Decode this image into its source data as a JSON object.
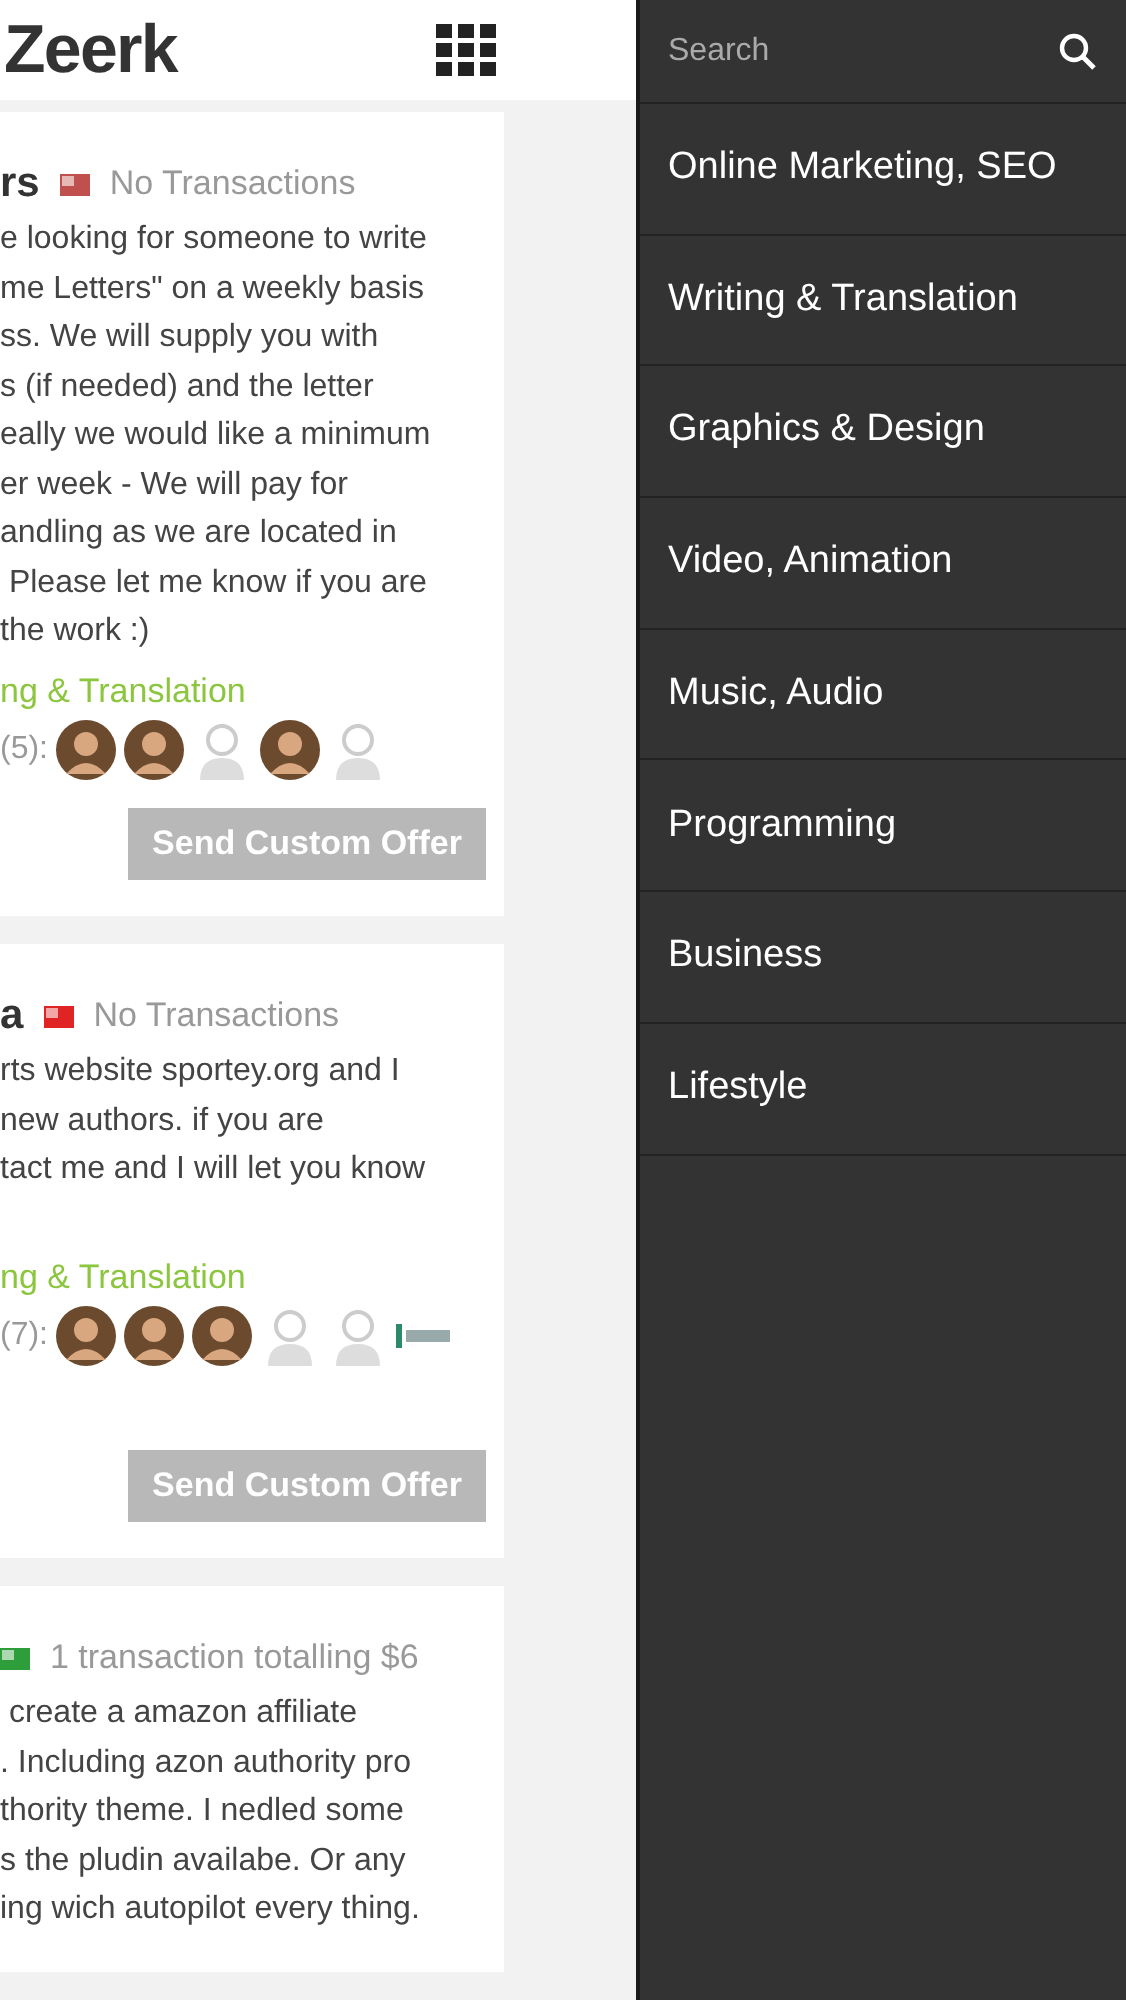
{
  "header": {
    "logo": "Zeerk"
  },
  "cards": [
    {
      "title": "rs",
      "flag": {
        "color": "#c0504d"
      },
      "status": "No Transactions",
      "body": [
        "e looking for someone to write",
        "me Letters\" on a weekly basis",
        "ss. We will supply you with",
        "s (if needed) and the letter",
        "eally we would like a minimum",
        "er week - We will pay for",
        "andling as we are located in",
        " Please let me know if you are",
        "the work :)"
      ],
      "category": "ng & Translation",
      "bidders": "(5):",
      "avatars": [
        {
          "kind": "photo"
        },
        {
          "kind": "photo"
        },
        {
          "kind": "placeholder"
        },
        {
          "kind": "photo"
        },
        {
          "kind": "placeholder"
        }
      ],
      "button": "Send Custom Offer"
    },
    {
      "title": "a",
      "flag": {
        "color": "#e02424"
      },
      "status": "No Transactions",
      "body": [
        "rts website sportey.org and I",
        "new authors. if you are",
        "tact me and I will let you know"
      ],
      "category": "ng & Translation",
      "bidders": "(7):",
      "avatars": [
        {
          "kind": "photo"
        },
        {
          "kind": "photo"
        },
        {
          "kind": "photo"
        },
        {
          "kind": "placeholder"
        },
        {
          "kind": "placeholder"
        },
        {
          "kind": "logo"
        }
      ],
      "button": "Send Custom Offer"
    },
    {
      "flag": {
        "color": "#2e9e3a"
      },
      "status": "1 transaction totalling $6",
      "body": [
        " create a amazon affiliate",
        ". Including azon authority pro",
        "thority theme. I nedled some",
        "s the pludin availabe. Or any",
        "ing wich autopilot every thing."
      ]
    }
  ],
  "drawer": {
    "search": {
      "placeholder": "Search"
    },
    "items": [
      {
        "label": "Online Marketing, SEO"
      },
      {
        "label": "Writing & Translation"
      },
      {
        "label": "Graphics & Design"
      },
      {
        "label": "Video, Animation"
      },
      {
        "label": "Music, Audio"
      },
      {
        "label": "Programming"
      },
      {
        "label": "Business"
      },
      {
        "label": "Lifestyle"
      }
    ]
  }
}
